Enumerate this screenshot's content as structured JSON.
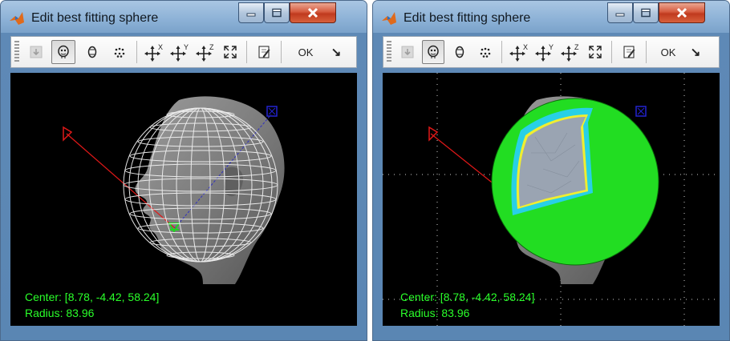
{
  "windows": [
    {
      "title": "Edit best fitting sphere",
      "toolbar": {
        "ok_label": "OK",
        "arrow_label": "↘"
      },
      "view": {
        "mode": "wireframe",
        "axes": {
          "x_label": "X",
          "z_label": "Z"
        }
      },
      "center_text": "Center: [8.78, -4.42, 58.24]",
      "radius_text": "Radius: 83.96"
    },
    {
      "title": "Edit best fitting sphere",
      "toolbar": {
        "ok_label": "OK",
        "arrow_label": "↘"
      },
      "view": {
        "mode": "solid",
        "axes": {
          "x_label": "X",
          "z_label": "Z"
        }
      },
      "center_text": "Center: [8.78, -4.42, 58.24]",
      "radius_text": "Radius: 83.96"
    }
  ],
  "colors": {
    "info_text": "#2aff2a",
    "sphere_fill": "#22dd22",
    "axis_x": "#ff2020",
    "axis_z": "#2020ff"
  },
  "icons": [
    "matlab-icon",
    "minimize-icon",
    "maximize-icon",
    "close-icon",
    "load-icon",
    "head-icon",
    "scalp-icon",
    "electrodes-icon",
    "move-x-icon",
    "move-y-icon",
    "move-z-icon",
    "resize-icon",
    "edit-icon",
    "ok-button",
    "expand-icon"
  ]
}
